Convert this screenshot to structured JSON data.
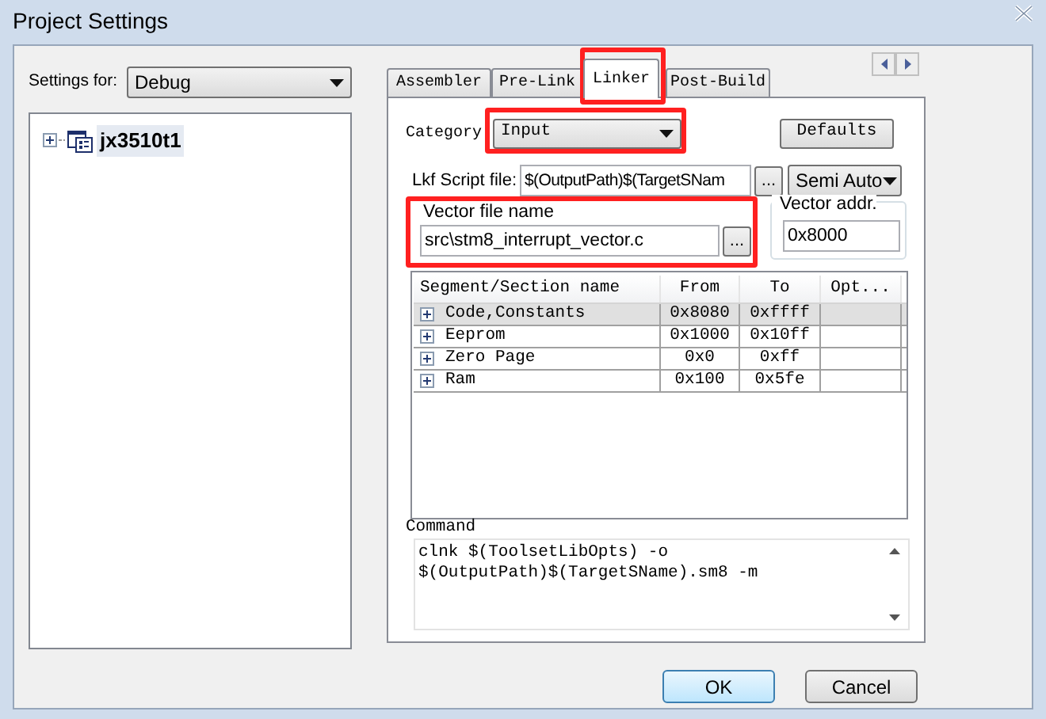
{
  "window": {
    "title": "Project Settings"
  },
  "settings_for": {
    "label": "Settings for:",
    "value": "Debug"
  },
  "tree": [
    {
      "label": "jx3510t1",
      "expanded": false,
      "selected": true
    }
  ],
  "tabs": [
    {
      "label": "Assembler",
      "selected": false
    },
    {
      "label": "Pre-Link",
      "selected": false
    },
    {
      "label": "Linker",
      "selected": true
    },
    {
      "label": "Post-Build",
      "selected": false
    }
  ],
  "category": {
    "label": "Category",
    "value": "Input"
  },
  "defaults_button": "Defaults",
  "lkf_script": {
    "label": "Lkf Script file:",
    "value": "$(OutputPath)$(TargetSNam",
    "browse": "...",
    "mode": "Semi Auto"
  },
  "vector_file": {
    "label": "Vector file name",
    "value": "src\\stm8_interrupt_vector.c",
    "browse": "..."
  },
  "vector_addr": {
    "label": "Vector addr.",
    "value": "0x8000"
  },
  "segments": {
    "columns": [
      "Segment/Section name",
      "From",
      "To",
      "Opt..."
    ],
    "rows": [
      {
        "name": "Code,Constants",
        "from": "0x8080",
        "to": "0xffff",
        "selected": true,
        "expanded": false
      },
      {
        "name": "Eeprom",
        "from": "0x1000",
        "to": "0x10ff",
        "selected": false,
        "expanded": false
      },
      {
        "name": "Zero Page",
        "from": "0x0",
        "to": "0xff",
        "selected": false,
        "expanded": false
      },
      {
        "name": "Ram",
        "from": "0x100",
        "to": "0x5fe",
        "selected": false,
        "expanded": false
      }
    ]
  },
  "command": {
    "label": "Command",
    "lines": [
      "clnk $(ToolsetLibOpts) -o",
      "$(OutputPath)$(TargetSName).sm8 -m"
    ]
  },
  "buttons": [
    {
      "label": "OK",
      "default": true
    },
    {
      "label": "Cancel",
      "default": false
    }
  ]
}
